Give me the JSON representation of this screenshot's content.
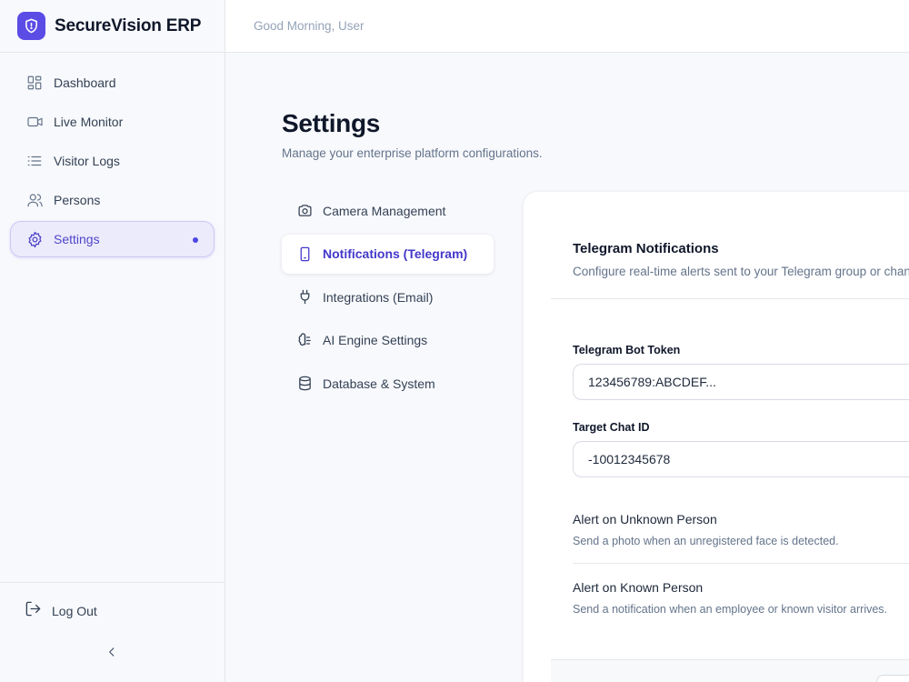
{
  "brand": {
    "name": "SecureVision ERP",
    "logo_icon": "shield-icon",
    "accent": "#5b4ce6"
  },
  "topbar": {
    "greeting": "Good Morning, User"
  },
  "sidebar": {
    "items": [
      {
        "label": "Dashboard",
        "icon": "grid-icon",
        "active": false
      },
      {
        "label": "Live Monitor",
        "icon": "video-camera-icon",
        "active": false
      },
      {
        "label": "Visitor Logs",
        "icon": "list-icon",
        "active": false
      },
      {
        "label": "Persons",
        "icon": "users-icon",
        "active": false
      },
      {
        "label": "Settings",
        "icon": "gear-icon",
        "active": true
      }
    ],
    "logout_label": "Log Out",
    "collapse_icon": "chevron-left-icon"
  },
  "page": {
    "title": "Settings",
    "subtitle": "Manage your enterprise platform configurations."
  },
  "settings_nav": {
    "items": [
      {
        "label": "Camera Management",
        "icon": "camera-icon",
        "active": false
      },
      {
        "label": "Notifications (Telegram)",
        "icon": "smartphone-icon",
        "active": true
      },
      {
        "label": "Integrations (Email)",
        "icon": "plug-icon",
        "active": false
      },
      {
        "label": "AI Engine Settings",
        "icon": "brain-icon",
        "active": false
      },
      {
        "label": "Database & System",
        "icon": "database-icon",
        "active": false
      }
    ]
  },
  "telegram": {
    "title": "Telegram Notifications",
    "description": "Configure real-time alerts sent to your Telegram group or chan",
    "bot_token_label": "Telegram Bot Token",
    "bot_token_value": "123456789:ABCDEF...",
    "chat_id_label": "Target Chat ID",
    "chat_id_value": "-10012345678",
    "alert_unknown_title": "Alert on Unknown Person",
    "alert_unknown_desc": "Send a photo when an unregistered face is detected.",
    "alert_known_title": "Alert on Known Person",
    "alert_known_desc": "Send a notification when an employee or known visitor arrives."
  }
}
